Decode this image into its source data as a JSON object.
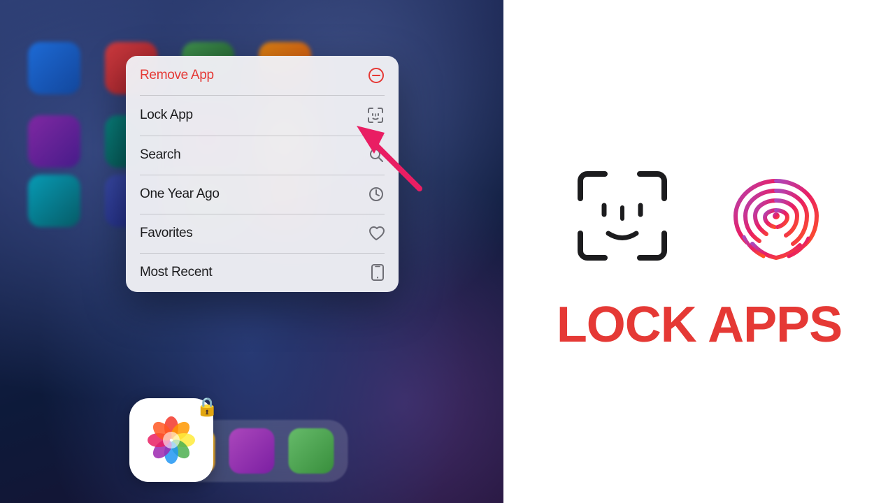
{
  "page": {
    "title": "Lock Apps"
  },
  "left_panel": {
    "phone_bg": true
  },
  "context_menu": {
    "items": [
      {
        "id": "remove-app",
        "label": "Remove App",
        "icon": "minus-circle",
        "color": "red"
      },
      {
        "id": "lock-app",
        "label": "Lock App",
        "icon": "face-id",
        "color": "normal"
      },
      {
        "id": "search",
        "label": "Search",
        "icon": "magnify",
        "color": "normal"
      },
      {
        "id": "one-year-ago",
        "label": "One Year Ago",
        "icon": "clock",
        "color": "normal"
      },
      {
        "id": "favorites",
        "label": "Favorites",
        "icon": "heart",
        "color": "normal"
      },
      {
        "id": "most-recent",
        "label": "Most Recent",
        "icon": "phone",
        "color": "normal"
      }
    ]
  },
  "right_panel": {
    "lock_apps_label": "LOCK APPS"
  }
}
